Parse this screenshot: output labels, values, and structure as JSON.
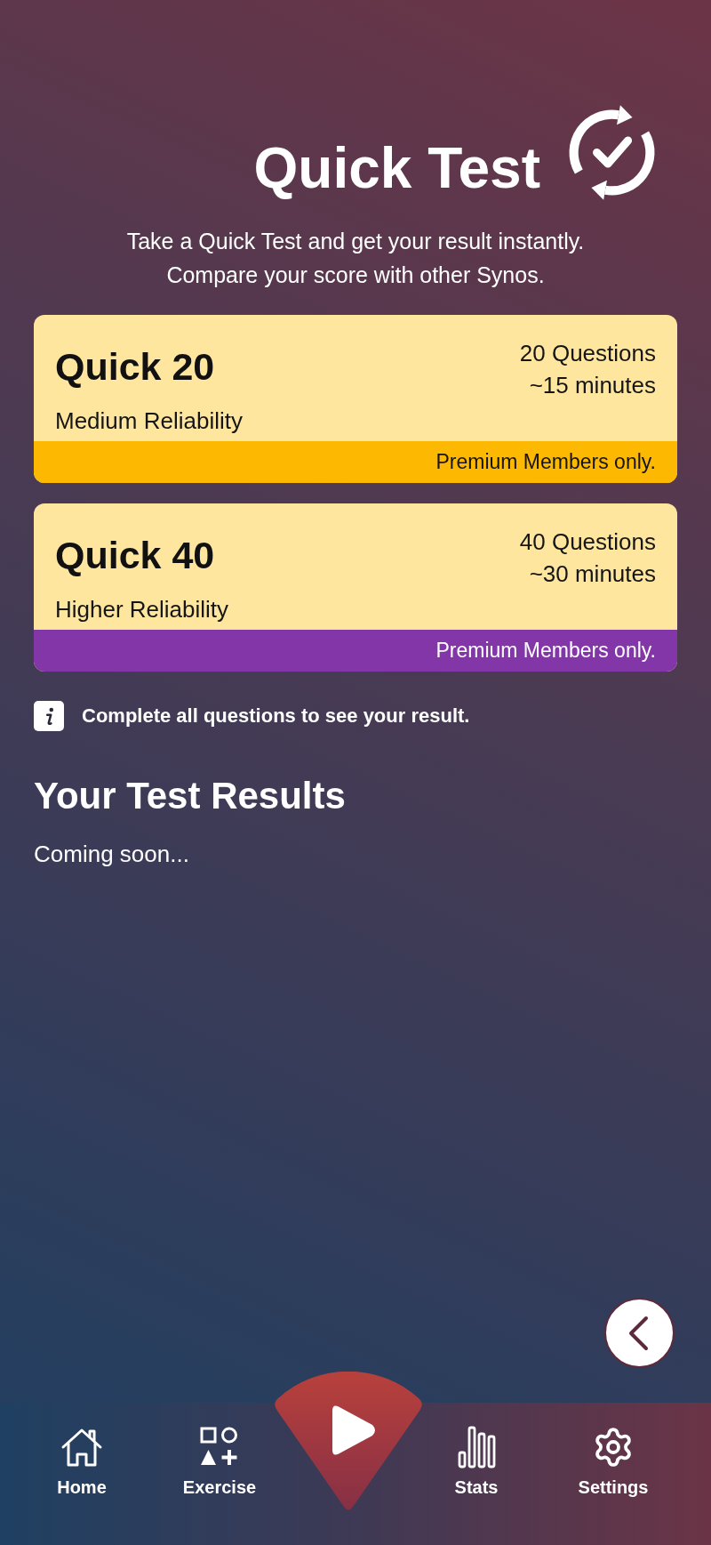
{
  "header": {
    "title": "Quick Test",
    "subtitle_lines": [
      "Take a Quick Test and get your result instantly.",
      "Compare your score with other Synos."
    ]
  },
  "tests": [
    {
      "name": "Quick 20",
      "reliability": "Medium Reliability",
      "details": [
        "20 Questions",
        "~15 minutes"
      ],
      "notice": "Premium Members only.",
      "color": "#fdb902"
    },
    {
      "name": "Quick 40",
      "reliability": "Higher Reliability",
      "details": [
        "40 Questions",
        "~30 minutes"
      ],
      "notice": "Premium Members only.",
      "color": "#8336a8"
    }
  ],
  "info": "Complete all questions to see your result.",
  "results": {
    "heading": "Your Test Results",
    "status": "Coming soon..."
  },
  "nav": {
    "items": [
      {
        "kind": "home",
        "label": "Home"
      },
      {
        "kind": "exercise",
        "label": "Exercise"
      },
      {
        "kind": "play"
      },
      {
        "kind": "stats",
        "label": "Stats"
      },
      {
        "kind": "settings",
        "label": "Settings"
      }
    ]
  }
}
